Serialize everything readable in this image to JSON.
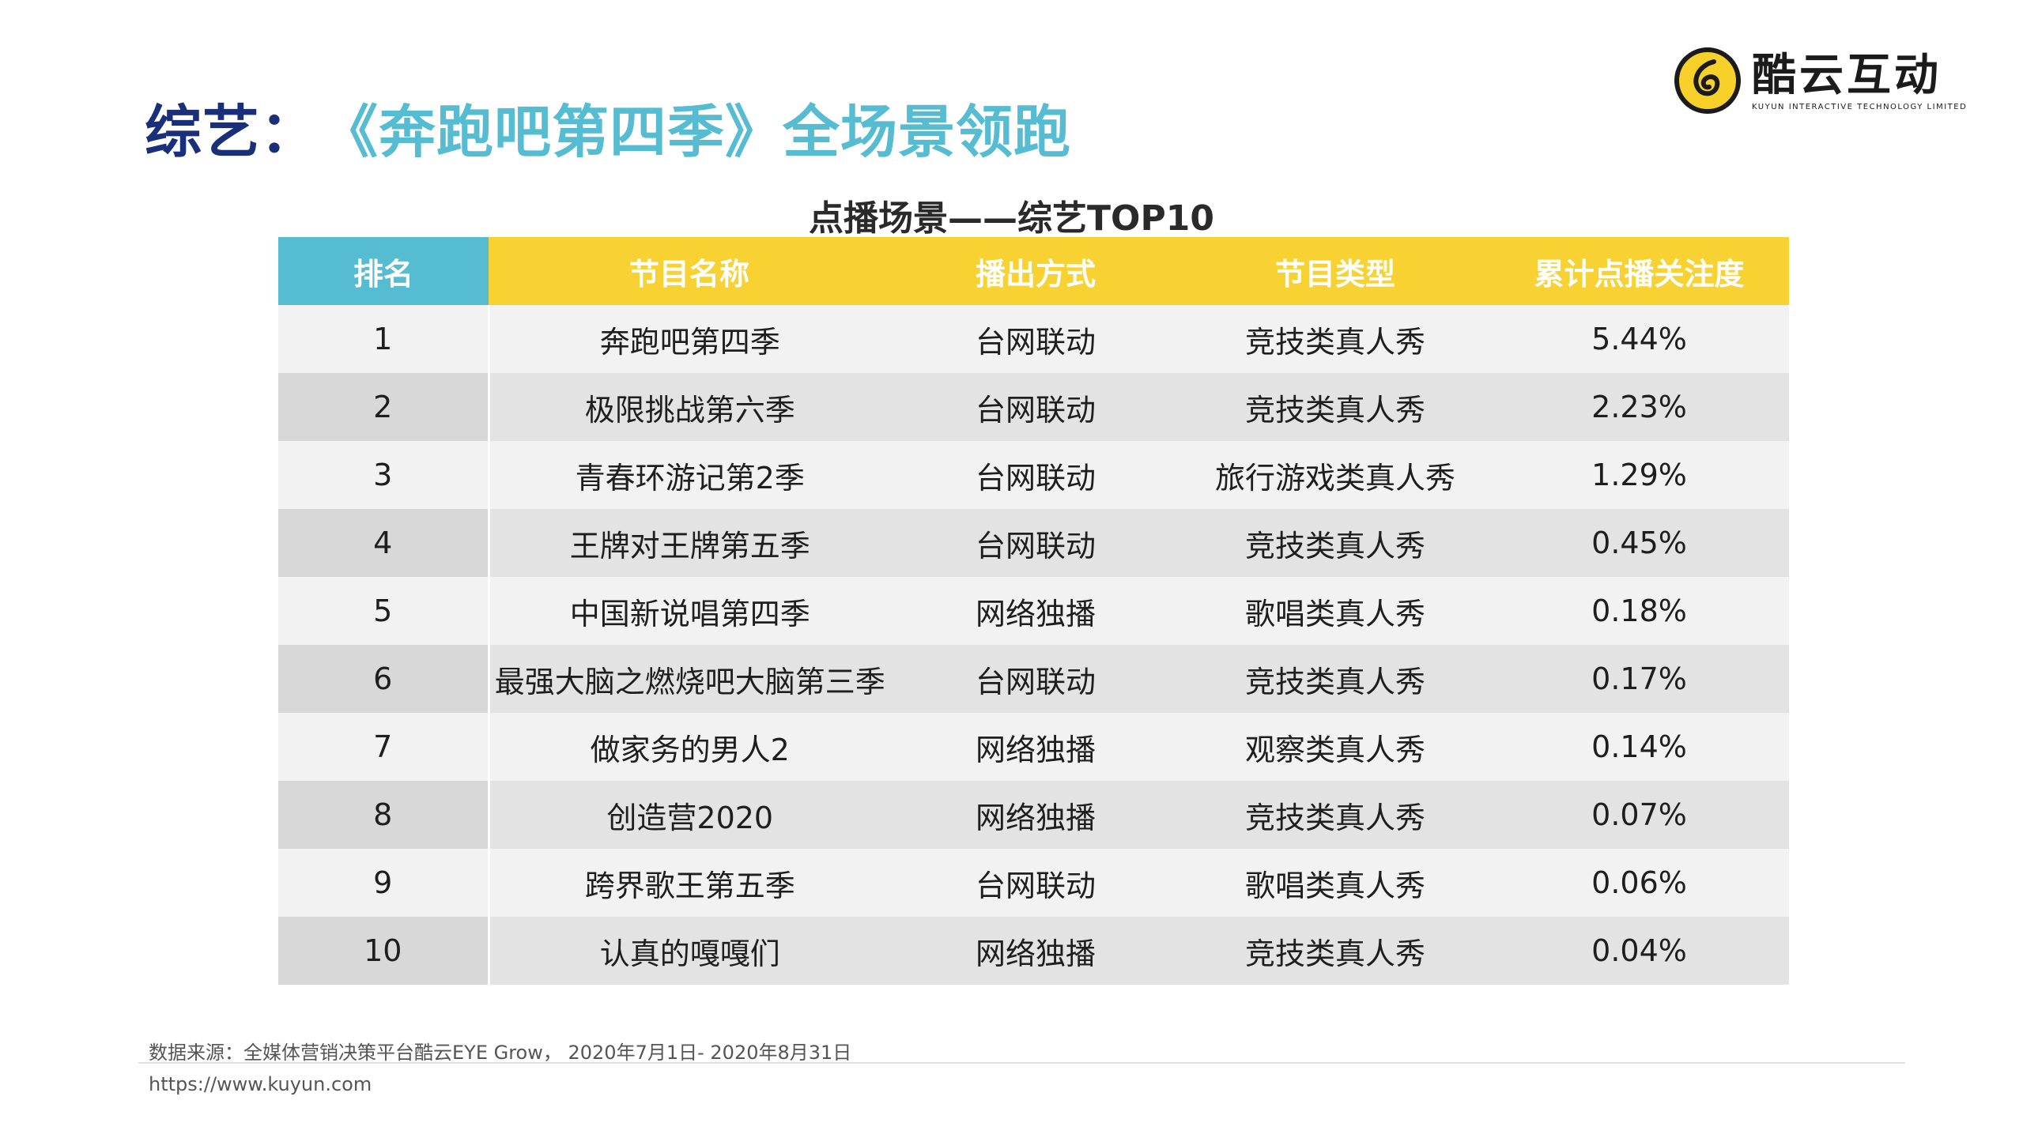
{
  "header": {
    "title_prefix": "综艺：",
    "title_main": "《奔跑吧第四季》全场景领跑"
  },
  "logo": {
    "name": "酷云互动",
    "subtitle": "KUYUN INTERACTIVE TECHNOLOGY LIMITED",
    "brand_color": "#f8d02a"
  },
  "table": {
    "title": "点播场景——综艺TOP10",
    "columns": [
      "排名",
      "节目名称",
      "播出方式",
      "节目类型",
      "累计点播关注度"
    ],
    "rows": [
      [
        "1",
        "奔跑吧第四季",
        "台网联动",
        "竞技类真人秀",
        "5.44%"
      ],
      [
        "2",
        "极限挑战第六季",
        "台网联动",
        "竞技类真人秀",
        "2.23%"
      ],
      [
        "3",
        "青春环游记第2季",
        "台网联动",
        "旅行游戏类真人秀",
        "1.29%"
      ],
      [
        "4",
        "王牌对王牌第五季",
        "台网联动",
        "竞技类真人秀",
        "0.45%"
      ],
      [
        "5",
        "中国新说唱第四季",
        "网络独播",
        "歌唱类真人秀",
        "0.18%"
      ],
      [
        "6",
        "最强大脑之燃烧吧大脑第三季",
        "台网联动",
        "竞技类真人秀",
        "0.17%"
      ],
      [
        "7",
        "做家务的男人2",
        "网络独播",
        "观察类真人秀",
        "0.14%"
      ],
      [
        "8",
        "创造营2020",
        "网络独播",
        "竞技类真人秀",
        "0.07%"
      ],
      [
        "9",
        "跨界歌王第五季",
        "台网联动",
        "歌唱类真人秀",
        "0.06%"
      ],
      [
        "10",
        "认真的嘎嘎们",
        "网络独播",
        "竞技类真人秀",
        "0.04%"
      ]
    ],
    "header_colors": {
      "rank": "#55bcd1",
      "others": "#f8d232"
    }
  },
  "footer": {
    "source": "数据来源：全媒体营销决策平台酷云EYE Grow，  2020年7月1日- 2020年8月31日",
    "url": "https://www.kuyun.com"
  }
}
